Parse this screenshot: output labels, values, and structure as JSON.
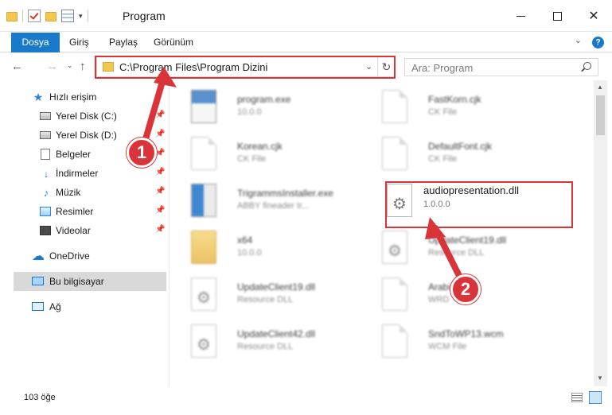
{
  "window": {
    "title": "Program",
    "controls": {
      "minimize": "minimize",
      "maximize": "maximize",
      "close": "✕"
    }
  },
  "ribbon": {
    "tabs": [
      {
        "label": "Dosya"
      },
      {
        "label": "Giriş"
      },
      {
        "label": "Paylaş"
      },
      {
        "label": "Görünüm"
      }
    ],
    "help_label": "?"
  },
  "navbar": {
    "address": "C:\\Program Files\\Program Dizini",
    "search_placeholder": "Ara: Program"
  },
  "nav_pane": {
    "items": [
      {
        "label": "Hızlı erişim",
        "icon": "star-icon"
      },
      {
        "label": "Yerel Disk (C:)",
        "icon": "drive-icon",
        "pinned": true
      },
      {
        "label": "Yerel Disk (D:)",
        "icon": "drive-icon",
        "pinned": true
      },
      {
        "label": "Belgeler",
        "icon": "document-icon",
        "pinned": true
      },
      {
        "label": "İndirmeler",
        "icon": "download-icon",
        "pinned": true
      },
      {
        "label": "Müzik",
        "icon": "music-icon",
        "pinned": true
      },
      {
        "label": "Resimler",
        "icon": "pictures-icon",
        "pinned": true
      },
      {
        "label": "Videolar",
        "icon": "videos-icon",
        "pinned": true
      },
      {
        "label": "OneDrive",
        "icon": "onedrive-icon"
      },
      {
        "label": "Bu bilgisayar",
        "icon": "computer-icon",
        "selected": true
      },
      {
        "label": "Ağ",
        "icon": "network-icon"
      }
    ]
  },
  "files": [
    {
      "name": "program.exe",
      "sub": "10.0.0"
    },
    {
      "name": "FastKorn.cjk",
      "sub": "CK File"
    },
    {
      "name": "Korean.cjk",
      "sub": "CK File"
    },
    {
      "name": "DefaultFont.cjk",
      "sub": "CK File"
    },
    {
      "name": "TrigrammsInstaller.exe",
      "sub": "ABBY fineader tr..."
    },
    {
      "name": "audiopresentation.dll",
      "sub": "1.0.0.0"
    },
    {
      "name": "x64",
      "sub": "10.0.0"
    },
    {
      "name": "UpdateClient19.dll",
      "sub": "Resource DLL"
    },
    {
      "name": "UpdateClient19.dll",
      "sub": "Resource DLL"
    },
    {
      "name": "Arabic",
      "sub": "WRD"
    },
    {
      "name": "UpdateClient42.dll",
      "sub": "Resource DLL"
    },
    {
      "name": "SndToWP13.wcm",
      "sub": "WCM File"
    }
  ],
  "status": {
    "count": "103 öğe"
  },
  "annotations": {
    "step1": "1",
    "step2": "2",
    "color": "#d9343a"
  }
}
